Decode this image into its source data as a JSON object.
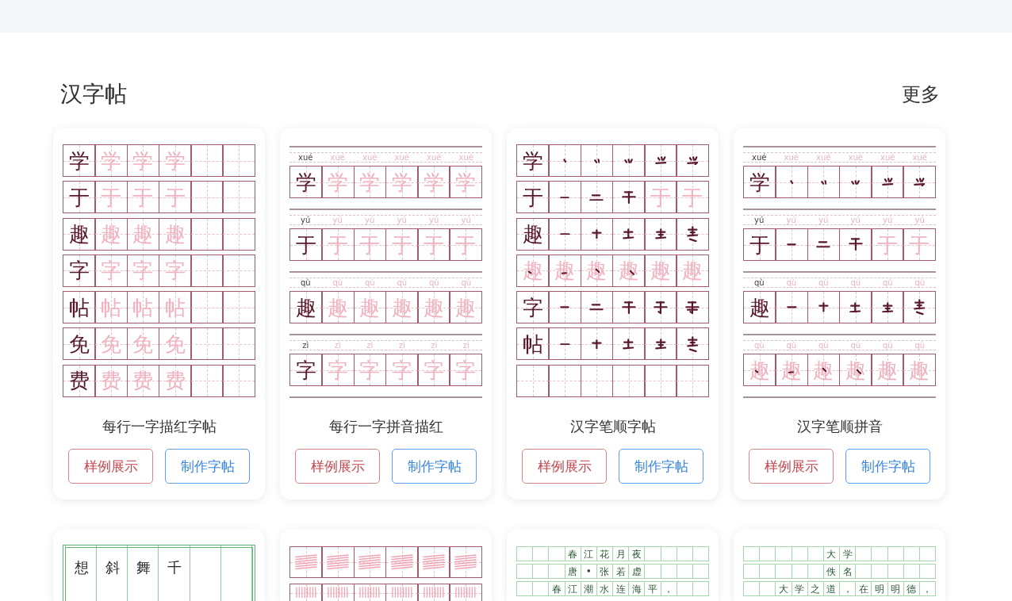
{
  "section": {
    "title": "汉字帖",
    "more": "更多"
  },
  "cards": [
    {
      "sheet": {
        "kind": "grid",
        "rows": [
          {
            "cells": [
              {
                "kind": "model",
                "text": "学"
              },
              {
                "kind": "trace",
                "text": "学"
              },
              {
                "kind": "trace",
                "text": "学"
              },
              {
                "kind": "trace",
                "text": "学"
              },
              {
                "kind": "blank"
              },
              {
                "kind": "blank"
              }
            ]
          },
          {
            "cells": [
              {
                "kind": "model",
                "text": "于"
              },
              {
                "kind": "trace",
                "text": "于"
              },
              {
                "kind": "trace",
                "text": "于"
              },
              {
                "kind": "trace",
                "text": "于"
              },
              {
                "kind": "blank"
              },
              {
                "kind": "blank"
              }
            ]
          },
          {
            "cells": [
              {
                "kind": "model",
                "text": "趣"
              },
              {
                "kind": "trace",
                "text": "趣"
              },
              {
                "kind": "trace",
                "text": "趣"
              },
              {
                "kind": "trace",
                "text": "趣"
              },
              {
                "kind": "blank"
              },
              {
                "kind": "blank"
              }
            ]
          },
          {
            "cells": [
              {
                "kind": "model",
                "text": "字"
              },
              {
                "kind": "trace",
                "text": "字"
              },
              {
                "kind": "trace",
                "text": "字"
              },
              {
                "kind": "trace",
                "text": "字"
              },
              {
                "kind": "blank"
              },
              {
                "kind": "blank"
              }
            ]
          },
          {
            "cells": [
              {
                "kind": "model",
                "text": "帖"
              },
              {
                "kind": "trace",
                "text": "帖"
              },
              {
                "kind": "trace",
                "text": "帖"
              },
              {
                "kind": "trace",
                "text": "帖"
              },
              {
                "kind": "blank"
              },
              {
                "kind": "blank"
              }
            ]
          },
          {
            "cells": [
              {
                "kind": "model",
                "text": "免"
              },
              {
                "kind": "trace",
                "text": "免"
              },
              {
                "kind": "trace",
                "text": "免"
              },
              {
                "kind": "trace",
                "text": "免"
              },
              {
                "kind": "blank"
              },
              {
                "kind": "blank"
              }
            ]
          },
          {
            "cells": [
              {
                "kind": "model",
                "text": "费"
              },
              {
                "kind": "trace",
                "text": "费"
              },
              {
                "kind": "trace",
                "text": "费"
              },
              {
                "kind": "trace",
                "text": "费"
              },
              {
                "kind": "blank"
              },
              {
                "kind": "blank"
              }
            ]
          }
        ]
      },
      "title": "每行一字描红字帖",
      "buttons": [
        {
          "kind": "sample",
          "label": "样例展示"
        },
        {
          "kind": "make",
          "label": "制作字帖"
        }
      ]
    },
    {
      "sheet": {
        "kind": "pinyin_grid",
        "rows": [
          {
            "pinyin": [
              {
                "kind": "model",
                "text": "xué"
              },
              {
                "kind": "trace",
                "text": "xué"
              },
              {
                "kind": "trace",
                "text": "xué"
              },
              {
                "kind": "trace",
                "text": "xué"
              },
              {
                "kind": "trace",
                "text": "xué"
              },
              {
                "kind": "trace",
                "text": "xué"
              }
            ],
            "cells": [
              {
                "kind": "model",
                "text": "学"
              },
              {
                "kind": "trace",
                "text": "学"
              },
              {
                "kind": "trace",
                "text": "学"
              },
              {
                "kind": "trace",
                "text": "学"
              },
              {
                "kind": "trace",
                "text": "学"
              },
              {
                "kind": "trace",
                "text": "学"
              }
            ]
          },
          {
            "pinyin": [
              {
                "kind": "model",
                "text": "yú"
              },
              {
                "kind": "trace",
                "text": "yú"
              },
              {
                "kind": "trace",
                "text": "yú"
              },
              {
                "kind": "trace",
                "text": "yú"
              },
              {
                "kind": "trace",
                "text": "yú"
              },
              {
                "kind": "trace",
                "text": "yú"
              }
            ],
            "cells": [
              {
                "kind": "model",
                "text": "于"
              },
              {
                "kind": "trace",
                "text": "于"
              },
              {
                "kind": "trace",
                "text": "于"
              },
              {
                "kind": "trace",
                "text": "于"
              },
              {
                "kind": "trace",
                "text": "于"
              },
              {
                "kind": "trace",
                "text": "于"
              }
            ]
          },
          {
            "pinyin": [
              {
                "kind": "model",
                "text": "qù"
              },
              {
                "kind": "trace",
                "text": "qù"
              },
              {
                "kind": "trace",
                "text": "qù"
              },
              {
                "kind": "trace",
                "text": "qù"
              },
              {
                "kind": "trace",
                "text": "qù"
              },
              {
                "kind": "trace",
                "text": "qù"
              }
            ],
            "cells": [
              {
                "kind": "model",
                "text": "趣"
              },
              {
                "kind": "trace",
                "text": "趣"
              },
              {
                "kind": "trace",
                "text": "趣"
              },
              {
                "kind": "trace",
                "text": "趣"
              },
              {
                "kind": "trace",
                "text": "趣"
              },
              {
                "kind": "trace",
                "text": "趣"
              }
            ]
          },
          {
            "pinyin": [
              {
                "kind": "model",
                "text": "zì"
              },
              {
                "kind": "trace",
                "text": "zì"
              },
              {
                "kind": "trace",
                "text": "zì"
              },
              {
                "kind": "trace",
                "text": "zì"
              },
              {
                "kind": "trace",
                "text": "zì"
              },
              {
                "kind": "trace",
                "text": "zì"
              }
            ],
            "cells": [
              {
                "kind": "model",
                "text": "字"
              },
              {
                "kind": "trace",
                "text": "字"
              },
              {
                "kind": "trace",
                "text": "字"
              },
              {
                "kind": "trace",
                "text": "字"
              },
              {
                "kind": "trace",
                "text": "字"
              },
              {
                "kind": "trace",
                "text": "字"
              }
            ]
          }
        ]
      },
      "title": "每行一字拼音描红",
      "buttons": [
        {
          "kind": "sample",
          "label": "样例展示"
        },
        {
          "kind": "make",
          "label": "制作字帖"
        }
      ]
    },
    {
      "sheet": {
        "kind": "grid",
        "rows": [
          {
            "cells": [
              {
                "kind": "model",
                "text": "学"
              },
              {
                "kind": "step"
              },
              {
                "kind": "step"
              },
              {
                "kind": "step"
              },
              {
                "kind": "step"
              },
              {
                "kind": "step"
              }
            ]
          },
          {
            "cells": [
              {
                "kind": "model",
                "text": "于"
              },
              {
                "kind": "step"
              },
              {
                "kind": "step"
              },
              {
                "kind": "step"
              },
              {
                "kind": "trace",
                "text": "于"
              },
              {
                "kind": "trace",
                "text": "于"
              }
            ]
          },
          {
            "cells": [
              {
                "kind": "model",
                "text": "趣"
              },
              {
                "kind": "step"
              },
              {
                "kind": "step"
              },
              {
                "kind": "step"
              },
              {
                "kind": "step"
              },
              {
                "kind": "step"
              }
            ]
          },
          {
            "cells": [
              {
                "kind": "trace_step",
                "text": "趣"
              },
              {
                "kind": "trace_step",
                "text": "趣"
              },
              {
                "kind": "trace_step",
                "text": "趣"
              },
              {
                "kind": "trace_step",
                "text": "趣"
              },
              {
                "kind": "trace",
                "text": "趣"
              },
              {
                "kind": "trace",
                "text": "趣"
              }
            ]
          },
          {
            "cells": [
              {
                "kind": "model",
                "text": "字"
              },
              {
                "kind": "step"
              },
              {
                "kind": "step"
              },
              {
                "kind": "step"
              },
              {
                "kind": "step"
              },
              {
                "kind": "step"
              }
            ]
          },
          {
            "cells": [
              {
                "kind": "model",
                "text": "帖"
              },
              {
                "kind": "step"
              },
              {
                "kind": "step"
              },
              {
                "kind": "step"
              },
              {
                "kind": "step"
              },
              {
                "kind": "step"
              }
            ]
          },
          {
            "cells": [
              {
                "kind": "blank"
              },
              {
                "kind": "blank"
              },
              {
                "kind": "blank"
              },
              {
                "kind": "blank"
              },
              {
                "kind": "blank"
              },
              {
                "kind": "blank"
              }
            ]
          }
        ]
      },
      "title": "汉字笔顺字帖",
      "buttons": [
        {
          "kind": "sample",
          "label": "样例展示"
        },
        {
          "kind": "make",
          "label": "制作字帖"
        }
      ]
    },
    {
      "sheet": {
        "kind": "pinyin_grid",
        "rows": [
          {
            "pinyin": [
              {
                "kind": "model",
                "text": "xué"
              },
              {
                "kind": "trace",
                "text": "xué"
              },
              {
                "kind": "trace",
                "text": "xué"
              },
              {
                "kind": "trace",
                "text": "xué"
              },
              {
                "kind": "trace",
                "text": "xué"
              },
              {
                "kind": "trace",
                "text": "xué"
              }
            ],
            "cells": [
              {
                "kind": "model",
                "text": "学"
              },
              {
                "kind": "step"
              },
              {
                "kind": "step"
              },
              {
                "kind": "step"
              },
              {
                "kind": "step"
              },
              {
                "kind": "step"
              }
            ]
          },
          {
            "pinyin": [
              {
                "kind": "model",
                "text": "yú"
              },
              {
                "kind": "trace",
                "text": "yú"
              },
              {
                "kind": "trace",
                "text": "yú"
              },
              {
                "kind": "trace",
                "text": "yú"
              },
              {
                "kind": "trace",
                "text": "yú"
              },
              {
                "kind": "trace",
                "text": "yú"
              }
            ],
            "cells": [
              {
                "kind": "model",
                "text": "于"
              },
              {
                "kind": "step"
              },
              {
                "kind": "step"
              },
              {
                "kind": "step"
              },
              {
                "kind": "trace",
                "text": "于"
              },
              {
                "kind": "trace",
                "text": "于"
              }
            ]
          },
          {
            "pinyin": [
              {
                "kind": "model",
                "text": "qù"
              },
              {
                "kind": "trace",
                "text": "qù"
              },
              {
                "kind": "trace",
                "text": "qù"
              },
              {
                "kind": "trace",
                "text": "qù"
              },
              {
                "kind": "trace",
                "text": "qù"
              },
              {
                "kind": "trace",
                "text": "qù"
              }
            ],
            "cells": [
              {
                "kind": "model",
                "text": "趣"
              },
              {
                "kind": "step"
              },
              {
                "kind": "step"
              },
              {
                "kind": "step"
              },
              {
                "kind": "step"
              },
              {
                "kind": "step"
              }
            ]
          },
          {
            "pinyin": [
              {
                "kind": "trace",
                "text": "qù"
              },
              {
                "kind": "trace",
                "text": "qù"
              },
              {
                "kind": "trace",
                "text": "qù"
              },
              {
                "kind": "trace",
                "text": "qù"
              },
              {
                "kind": "trace",
                "text": "qù"
              },
              {
                "kind": "trace",
                "text": "qù"
              }
            ],
            "cells": [
              {
                "kind": "trace_step",
                "text": "趣"
              },
              {
                "kind": "trace_step",
                "text": "趣"
              },
              {
                "kind": "trace_step",
                "text": "趣"
              },
              {
                "kind": "trace_step",
                "text": "趣"
              },
              {
                "kind": "trace",
                "text": "趣"
              },
              {
                "kind": "trace",
                "text": "趣"
              }
            ]
          }
        ]
      },
      "title": "汉字笔顺拼音",
      "buttons": [
        {
          "kind": "sample",
          "label": "样例展示"
        },
        {
          "kind": "make",
          "label": "制作字帖"
        }
      ]
    },
    {
      "sheet": {
        "kind": "vertical",
        "columns": [
          {
            "kind": "char",
            "text": "想"
          },
          {
            "kind": "char",
            "text": "斜"
          },
          {
            "kind": "char",
            "text": "舞"
          },
          {
            "kind": "char",
            "text": "千"
          },
          {
            "kind": "blank"
          },
          {
            "kind": "blank"
          }
        ]
      }
    },
    {
      "sheet": {
        "kind": "drill",
        "rows": [
          {
            "cells": [
              {
                "kind": "horizontal"
              },
              {
                "kind": "horizontal"
              },
              {
                "kind": "horizontal"
              },
              {
                "kind": "horizontal"
              },
              {
                "kind": "horizontal"
              },
              {
                "kind": "horizontal"
              }
            ]
          },
          {
            "cells": [
              {
                "kind": "vertical"
              },
              {
                "kind": "vertical"
              },
              {
                "kind": "vertical"
              },
              {
                "kind": "vertical"
              },
              {
                "kind": "vertical"
              },
              {
                "kind": "vertical"
              }
            ]
          }
        ]
      }
    },
    {
      "sheet": {
        "kind": "poem",
        "rows": [
          {
            "cells": [
              {
                "kind": "blank"
              },
              {
                "kind": "blank"
              },
              {
                "kind": "blank"
              },
              {
                "kind": "char",
                "text": "春"
              },
              {
                "kind": "char",
                "text": "江"
              },
              {
                "kind": "char",
                "text": "花"
              },
              {
                "kind": "char",
                "text": "月"
              },
              {
                "kind": "char",
                "text": "夜"
              },
              {
                "kind": "blank"
              },
              {
                "kind": "blank"
              },
              {
                "kind": "blank"
              },
              {
                "kind": "blank"
              }
            ]
          },
          {
            "cells": [
              {
                "kind": "blank"
              },
              {
                "kind": "blank"
              },
              {
                "kind": "blank"
              },
              {
                "kind": "char",
                "text": "唐"
              },
              {
                "kind": "char",
                "text": "•"
              },
              {
                "kind": "char",
                "text": "张"
              },
              {
                "kind": "char",
                "text": "若"
              },
              {
                "kind": "char",
                "text": "虚"
              },
              {
                "kind": "blank"
              },
              {
                "kind": "blank"
              },
              {
                "kind": "blank"
              },
              {
                "kind": "blank"
              }
            ]
          },
          {
            "cells": [
              {
                "kind": "blank"
              },
              {
                "kind": "blank"
              },
              {
                "kind": "char",
                "text": "春"
              },
              {
                "kind": "char",
                "text": "江"
              },
              {
                "kind": "char",
                "text": "潮"
              },
              {
                "kind": "char",
                "text": "水"
              },
              {
                "kind": "char",
                "text": "连"
              },
              {
                "kind": "char",
                "text": "海"
              },
              {
                "kind": "char",
                "text": "平"
              },
              {
                "kind": "char",
                "text": "，"
              },
              {
                "kind": "blank"
              },
              {
                "kind": "blank"
              }
            ]
          }
        ]
      }
    },
    {
      "sheet": {
        "kind": "poem",
        "rows": [
          {
            "cells": [
              {
                "kind": "blank"
              },
              {
                "kind": "blank"
              },
              {
                "kind": "blank"
              },
              {
                "kind": "blank"
              },
              {
                "kind": "blank"
              },
              {
                "kind": "char",
                "text": "大"
              },
              {
                "kind": "char",
                "text": "学"
              },
              {
                "kind": "blank"
              },
              {
                "kind": "blank"
              },
              {
                "kind": "blank"
              },
              {
                "kind": "blank"
              },
              {
                "kind": "blank"
              }
            ]
          },
          {
            "cells": [
              {
                "kind": "blank"
              },
              {
                "kind": "blank"
              },
              {
                "kind": "blank"
              },
              {
                "kind": "blank"
              },
              {
                "kind": "blank"
              },
              {
                "kind": "char",
                "text": "佚"
              },
              {
                "kind": "char",
                "text": "名"
              },
              {
                "kind": "blank"
              },
              {
                "kind": "blank"
              },
              {
                "kind": "blank"
              },
              {
                "kind": "blank"
              },
              {
                "kind": "blank"
              }
            ]
          },
          {
            "cells": [
              {
                "kind": "blank"
              },
              {
                "kind": "blank"
              },
              {
                "kind": "char",
                "text": "大"
              },
              {
                "kind": "char",
                "text": "学"
              },
              {
                "kind": "char",
                "text": "之"
              },
              {
                "kind": "char",
                "text": "道"
              },
              {
                "kind": "char",
                "text": "，"
              },
              {
                "kind": "char",
                "text": "在"
              },
              {
                "kind": "char",
                "text": "明"
              },
              {
                "kind": "char",
                "text": "明"
              },
              {
                "kind": "char",
                "text": "德"
              },
              {
                "kind": "char",
                "text": "，"
              }
            ]
          }
        ]
      }
    }
  ]
}
